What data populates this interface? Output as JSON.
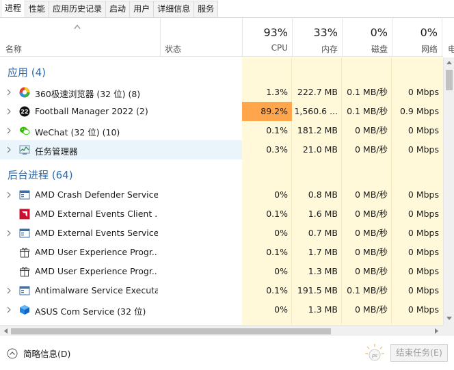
{
  "tabs": [
    {
      "label": "进程",
      "active": true
    },
    {
      "label": "性能"
    },
    {
      "label": "应用历史记录"
    },
    {
      "label": "启动"
    },
    {
      "label": "用户"
    },
    {
      "label": "详细信息"
    },
    {
      "label": "服务"
    }
  ],
  "header": {
    "name_label": "名称",
    "status_label": "状态",
    "cpu": {
      "pct": "93%",
      "label": "CPU"
    },
    "memory": {
      "pct": "33%",
      "label": "内存"
    },
    "disk": {
      "pct": "0%",
      "label": "磁盘"
    },
    "network": {
      "pct": "0%",
      "label": "网络"
    },
    "power_label": "电"
  },
  "groups": {
    "apps": "应用 (4)",
    "background": "后台进程 (64)"
  },
  "apps": [
    {
      "icon": "360-browser-icon",
      "name": "360极速浏览器 (32 位) (8)",
      "cpu": "1.3%",
      "mem": "222.7 MB",
      "disk": "0.1 MB/秒",
      "net": "0 Mbps"
    },
    {
      "icon": "football-manager-icon",
      "name": "Football Manager 2022 (2)",
      "cpu": "89.2%",
      "mem": "1,560.6 ...",
      "disk": "0.1 MB/秒",
      "net": "0.9 Mbps"
    },
    {
      "icon": "wechat-icon",
      "name": "WeChat (32 位) (10)",
      "cpu": "0.1%",
      "mem": "181.2 MB",
      "disk": "0 MB/秒",
      "net": "0 Mbps"
    },
    {
      "icon": "task-manager-icon",
      "name": "任务管理器",
      "cpu": "0.3%",
      "mem": "21.0 MB",
      "disk": "0 MB/秒",
      "net": "0 Mbps"
    }
  ],
  "background": [
    {
      "icon": "service-window-icon",
      "name": "AMD Crash Defender Service",
      "cpu": "0%",
      "mem": "0.8 MB",
      "disk": "0 MB/秒",
      "net": "0 Mbps"
    },
    {
      "icon": "amd-logo-icon",
      "name": "AMD External Events Client ...",
      "cpu": "0.1%",
      "mem": "1.6 MB",
      "disk": "0 MB/秒",
      "net": "0 Mbps"
    },
    {
      "icon": "service-window-icon",
      "name": "AMD External Events Service ...",
      "cpu": "0%",
      "mem": "0.7 MB",
      "disk": "0 MB/秒",
      "net": "0 Mbps"
    },
    {
      "icon": "gift-box-icon",
      "name": "AMD User Experience Progr...",
      "cpu": "0.1%",
      "mem": "1.7 MB",
      "disk": "0 MB/秒",
      "net": "0 Mbps"
    },
    {
      "icon": "gift-box-icon",
      "name": "AMD User Experience Progr...",
      "cpu": "0%",
      "mem": "1.3 MB",
      "disk": "0 MB/秒",
      "net": "0 Mbps"
    },
    {
      "icon": "service-window-icon",
      "name": "Antimalware Service Executa...",
      "cpu": "0.1%",
      "mem": "191.5 MB",
      "disk": "0.1 MB/秒",
      "net": "0 Mbps"
    },
    {
      "icon": "asus-cube-icon",
      "name": "ASUS Com Service (32 位)",
      "cpu": "0%",
      "mem": "1.3 MB",
      "disk": "0 MB/秒",
      "net": "0 Mbps"
    }
  ],
  "footer": {
    "fewer_details": "简略信息(D)",
    "end_task": "结束任务(E)"
  },
  "colors": {
    "accent": "#2b6ab3",
    "heat_low": "#fff8d9",
    "heat_high": "#ffa64d",
    "selected": "#eaf4fb"
  }
}
